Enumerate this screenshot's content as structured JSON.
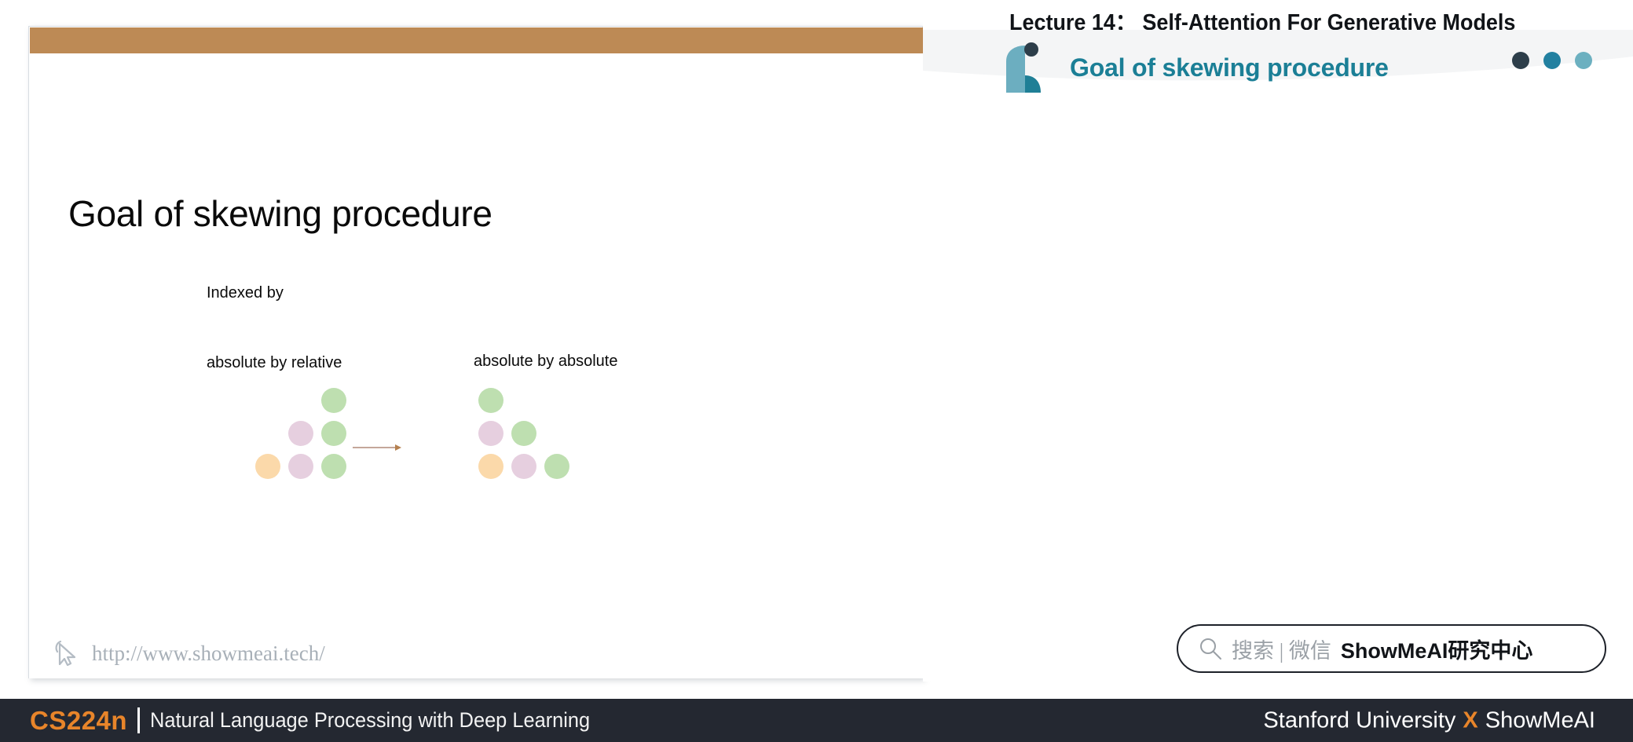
{
  "footer": {
    "course_code": "CS224n",
    "subtitle": "Natural Language Processing with Deep Learning",
    "org_left": "Stanford University",
    "org_x": "X",
    "org_right": "ShowMeAI"
  },
  "notes_panel": {
    "lecture_title": "Lecture 14： Self-Attention For Generative Models",
    "section_heading": "Goal of skewing procedure",
    "header_dots": [
      "#2d3e4a",
      "#2280a0",
      "#6cb0c0"
    ],
    "accent_color": "#1b7f96",
    "search": {
      "placeholder": "搜索 | 微信",
      "brand": "ShowMeAI研究中心"
    }
  },
  "slide": {
    "topbar_color": "#bd8a55",
    "title": "Goal of skewing procedure",
    "indexed_label": "Indexed by",
    "left_matrix_label": "absolute by relative",
    "right_matrix_label": "absolute by absolute",
    "watermark_url": "http://www.showmeai.tech/",
    "dot_colors": {
      "green": "#bedfb0",
      "pink": "#e6cfdf",
      "orange": "#fbd9aa"
    },
    "left_matrix": [
      [
        null,
        null,
        "green"
      ],
      [
        null,
        "pink",
        "green"
      ],
      [
        "orange",
        "pink",
        "green"
      ]
    ],
    "right_matrix": [
      [
        "green",
        null,
        null
      ],
      [
        "pink",
        "green",
        null
      ],
      [
        "orange",
        "pink",
        "green"
      ]
    ]
  }
}
